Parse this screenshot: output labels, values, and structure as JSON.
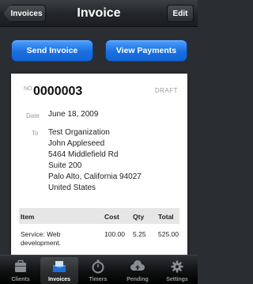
{
  "navbar": {
    "back_label": "Invoices",
    "title": "Invoice",
    "edit_label": "Edit"
  },
  "actions": {
    "send_label": "Send Invoice",
    "payments_label": "View Payments"
  },
  "invoice": {
    "number_label": "NO",
    "number": "0000003",
    "status": "DRAFT",
    "date_label": "Date",
    "date": "June 18, 2009",
    "to_label": "To",
    "address_lines": [
      "Test Organization",
      "John Appleseed",
      "5464 Middlefield Rd",
      "Suite 200",
      "Palo Alto, California 94027",
      "United States"
    ],
    "table": {
      "headers": [
        "Item",
        "Cost",
        "Qty",
        "Total"
      ],
      "rows": [
        {
          "item": "Service: Web development.",
          "cost": "100.00",
          "qty": "5.25",
          "total": "525.00"
        }
      ]
    }
  },
  "tabbar": {
    "tabs": [
      {
        "label": "Clients",
        "icon": "clients-icon"
      },
      {
        "label": "Invoices",
        "icon": "invoices-icon"
      },
      {
        "label": "Timers",
        "icon": "timer-icon"
      },
      {
        "label": "Pending",
        "icon": "cloud-upload-icon"
      },
      {
        "label": "Settings",
        "icon": "gear-icon"
      }
    ],
    "active_tab": "Invoices"
  }
}
